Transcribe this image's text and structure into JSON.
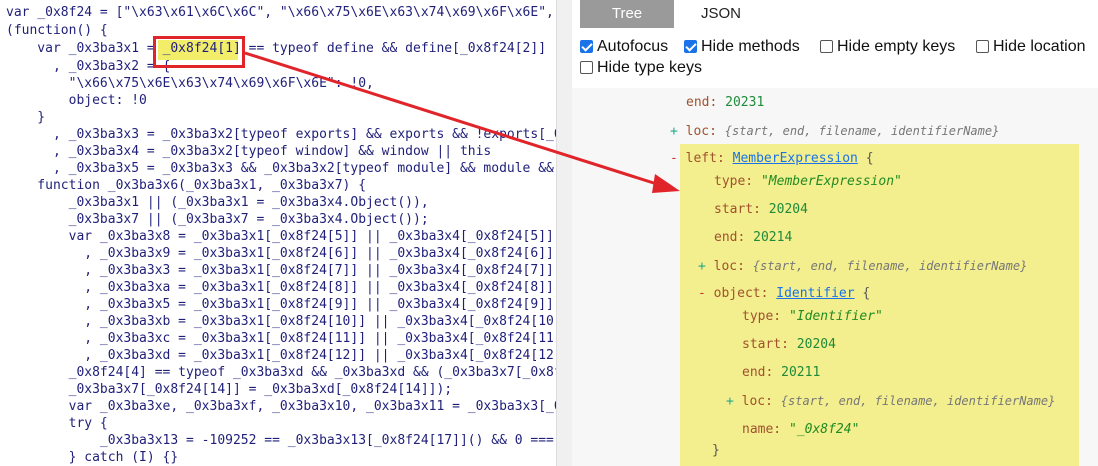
{
  "code": {
    "lines": [
      "var _0x8f24 = [\"\\x63\\x61\\x6C\\x6C\", \"\\x66\\x75\\x6E\\x63\\x74\\x69\\x6F\\x6E\",",
      "(function() {",
      "    var _0x3ba3x1 = _0x8f24[1] == typeof define && define[_0x8f24[2]]",
      "      , _0x3ba3x2 = {",
      "        \"\\x66\\x75\\x6E\\x63\\x74\\x69\\x6F\\x6E\": !0,",
      "        object: !0",
      "    }",
      "      , _0x3ba3x3 = _0x3ba3x2[typeof exports] && exports && !exports[_0",
      "      , _0x3ba3x4 = _0x3ba3x2[typeof window] && window || this",
      "      , _0x3ba3x5 = _0x3ba3x3 && _0x3ba3x2[typeof module] && module &&",
      "    function _0x3ba3x6(_0x3ba3x1, _0x3ba3x7) {",
      "        _0x3ba3x1 || (_0x3ba3x1 = _0x3ba3x4.Object()),",
      "        _0x3ba3x7 || (_0x3ba3x7 = _0x3ba3x4.Object());",
      "        var _0x3ba3x8 = _0x3ba3x1[_0x8f24[5]] || _0x3ba3x4[_0x8f24[5]]",
      "          , _0x3ba3x9 = _0x3ba3x1[_0x8f24[6]] || _0x3ba3x4[_0x8f24[6]]",
      "          , _0x3ba3x3 = _0x3ba3x1[_0x8f24[7]] || _0x3ba3x4[_0x8f24[7]]",
      "          , _0x3ba3xa = _0x3ba3x1[_0x8f24[8]] || _0x3ba3x4[_0x8f24[8]]",
      "          , _0x3ba3x5 = _0x3ba3x1[_0x8f24[9]] || _0x3ba3x4[_0x8f24[9]]",
      "          , _0x3ba3xb = _0x3ba3x1[_0x8f24[10]] || _0x3ba3x4[_0x8f24[10]",
      "          , _0x3ba3xc = _0x3ba3x1[_0x8f24[11]] || _0x3ba3x4[_0x8f24[11]",
      "          , _0x3ba3xd = _0x3ba3x1[_0x8f24[12]] || _0x3ba3x4[_0x8f24[12]",
      "        _0x8f24[4] == typeof _0x3ba3xd && _0x3ba3xd && (_0x3ba3x7[_0x8f",
      "        _0x3ba3x7[_0x8f24[14]] = _0x3ba3xd[_0x8f24[14]]);",
      "        var _0x3ba3xe, _0x3ba3xf, _0x3ba3x10, _0x3ba3x11 = _0x3ba3x3[_0",
      "        try {",
      "            _0x3ba3x13 = -109252 == _0x3ba3x13[_0x8f24[17]]() && 0 === _",
      "        } catch (I) {}"
    ],
    "highlight": "_0x8f24[1]"
  },
  "tabs": {
    "tree": "Tree",
    "json": "JSON"
  },
  "options": [
    {
      "label": "Autofocus",
      "checked": true
    },
    {
      "label": "Hide methods",
      "checked": true
    },
    {
      "label": "Hide empty keys",
      "checked": false
    },
    {
      "label": "Hide location",
      "checked": false
    },
    {
      "label": "Hide type keys",
      "checked": false
    }
  ],
  "tree": {
    "end_key": "end:",
    "end_val": "20231",
    "loc_key": "loc:",
    "loc_meta": "{start, end, filename, identifierName}",
    "left_key": "left:",
    "left_type": "MemberExpression",
    "brace": "{",
    "type_key": "type:",
    "type_val": "\"MemberExpression\"",
    "start_key": "start:",
    "start_val": "20204",
    "end2_key": "end:",
    "end2_val": "20214",
    "loc2_key": "loc:",
    "loc2_meta": "{start, end, filename, identifierName}",
    "object_key": "object:",
    "object_type": "Identifier",
    "brace2": "{",
    "type2_key": "type:",
    "type2_val": "\"Identifier\"",
    "start2_key": "start:",
    "start2_val": "20204",
    "end3_key": "end:",
    "end3_val": "20211",
    "loc3_key": "loc:",
    "loc3_meta": "{start, end, filename, identifierName}",
    "name_key": "name:",
    "name_val": "\"_0x8f24\"",
    "close_brace": "}",
    "plus": "+",
    "minus": "-"
  },
  "colors": {
    "annotation": "#e0242a",
    "highlight": "#f3ee8e"
  }
}
